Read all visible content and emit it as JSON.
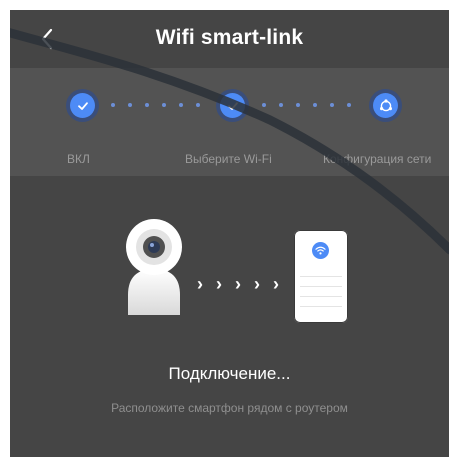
{
  "header": {
    "title": "Wifi smart-link",
    "back_icon": "chevron-left-icon"
  },
  "steps": [
    {
      "label": "ВКЛ",
      "state": "done",
      "icon": "check-icon"
    },
    {
      "label": "Выберите Wi-Fi",
      "state": "done",
      "icon": "check-icon"
    },
    {
      "label": "Конфигурация сети",
      "state": "active",
      "icon": "network-config-icon"
    }
  ],
  "illustration": {
    "camera_icon": "camera-icon",
    "arrows": "› › › › ›",
    "phone_icon": "phone-router-icon",
    "wifi_icon": "wifi-icon"
  },
  "status": {
    "title": "Подключение...",
    "hint": "Расположите смартфон рядом с роутером"
  },
  "colors": {
    "accent": "#4d8bf6",
    "background": "#454545",
    "stepper_band": "#535353"
  }
}
